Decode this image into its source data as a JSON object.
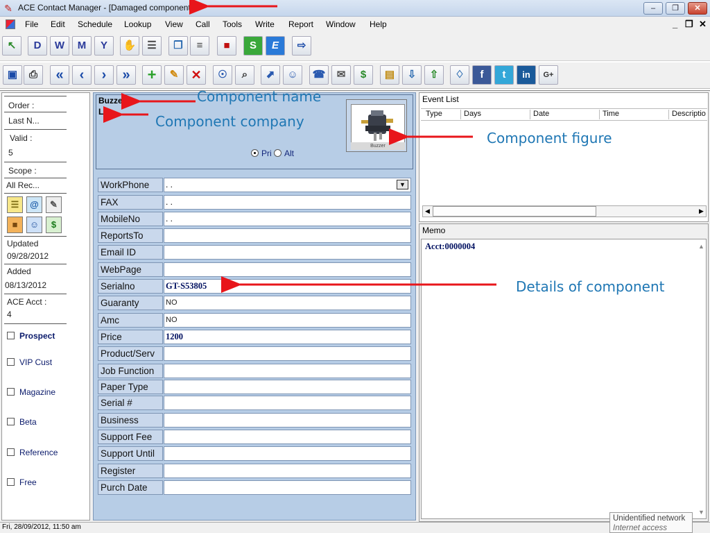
{
  "window": {
    "title": "ACE Contact Manager - [Damaged component]",
    "controls": [
      "minimize",
      "restore",
      "close"
    ]
  },
  "menu": {
    "items": [
      "File",
      "Edit",
      "Schedule",
      "Lookup",
      "View",
      "Call",
      "Tools",
      "Write",
      "Report",
      "Window",
      "Help"
    ],
    "mdi_controls": [
      "_",
      "❐",
      "✕"
    ]
  },
  "toolbar1": {
    "buttons": [
      "open-folder",
      "calendar-d",
      "calendar-w",
      "calendar-m",
      "calendar-y",
      "clipboard",
      "notes",
      "copy",
      "list",
      "phonebook",
      "dollar-s",
      "euro-e",
      "exit"
    ],
    "glyphs": [
      "↖",
      "D",
      "W",
      "M",
      "Y",
      "✋",
      "☰",
      "❐",
      "≡",
      "■",
      "S",
      "E",
      "⇨"
    ]
  },
  "toolbar2": {
    "buttons": [
      "save",
      "print",
      "first",
      "previous",
      "next",
      "last",
      "add",
      "edit",
      "delete",
      "find",
      "search",
      "import",
      "contact-info",
      "phone",
      "fax",
      "dollar",
      "folder-in",
      "inbox-in",
      "inbox-out",
      "book",
      "facebook",
      "twitter",
      "linkedin",
      "google"
    ],
    "glyphs": [
      "▣",
      "⎙",
      "«",
      "‹",
      "›",
      "»",
      "+",
      "✎",
      "✕",
      "☉",
      "⌕",
      "⬈",
      "☺",
      "☎",
      "✉",
      "$",
      "▤",
      "⇩",
      "⇧",
      "♢",
      "f",
      "t",
      "in",
      "G+"
    ]
  },
  "left_panel": {
    "order_label": "Order :",
    "order_value": "Last N...",
    "valid_label": "Valid   :",
    "valid_value": "5",
    "scope_label": "Scope :",
    "scope_value": "All Rec...",
    "updated_label": "Updated",
    "updated_value": "09/28/2012",
    "added_label": "Added",
    "added_value": "08/13/2012",
    "acct_label": "ACE Acct :",
    "acct_value": "4",
    "checkboxes": [
      "Prospect",
      "VIP Cust",
      "Magazine",
      "Beta",
      "Reference",
      "Free"
    ]
  },
  "component": {
    "name": "Buzzer",
    "company": "LG",
    "figure_caption": "Buzzer",
    "radio_pri": "Pri",
    "radio_alt": "Alt"
  },
  "fields": [
    {
      "label": "WorkPhone",
      "value": ". ."
    },
    {
      "label": "FAX",
      "value": ". ."
    },
    {
      "label": "MobileNo",
      "value": ". ."
    },
    {
      "label": "ReportsTo",
      "value": ""
    },
    {
      "label": "Email ID",
      "value": ""
    },
    {
      "label": "WebPage",
      "value": ""
    },
    {
      "label": "Serialno",
      "value": "GT-S53805"
    },
    {
      "label": "Guaranty",
      "value": "NO"
    },
    {
      "label": "Amc",
      "value": "NO"
    },
    {
      "label": "Price",
      "value": "1200"
    },
    {
      "label": "Product/Serv",
      "value": ""
    },
    {
      "label": "Job Function",
      "value": ""
    },
    {
      "label": "Paper Type",
      "value": ""
    },
    {
      "label": "Serial #",
      "value": ""
    },
    {
      "label": "Business",
      "value": ""
    },
    {
      "label": "Support Fee",
      "value": ""
    },
    {
      "label": "Support Until",
      "value": ""
    },
    {
      "label": "Register",
      "value": ""
    },
    {
      "label": "Purch Date",
      "value": ""
    }
  ],
  "event_list": {
    "title": "Event List",
    "columns": [
      "Type",
      "Days",
      "Date",
      "Time",
      "Descriptio"
    ]
  },
  "memo": {
    "title": "Memo",
    "text": "Acct:0000004"
  },
  "status": {
    "datetime": "Fri, 28/09/2012, 11:50 am",
    "network_title": "Unidentified network",
    "network_sub": "Internet access"
  },
  "annotations": {
    "component_name": "Component name",
    "component_company": "Component company",
    "component_figure": "Component figure",
    "details": "Details of component",
    "arrow_color": "#e8161b",
    "text_color": "#1f77b4"
  }
}
